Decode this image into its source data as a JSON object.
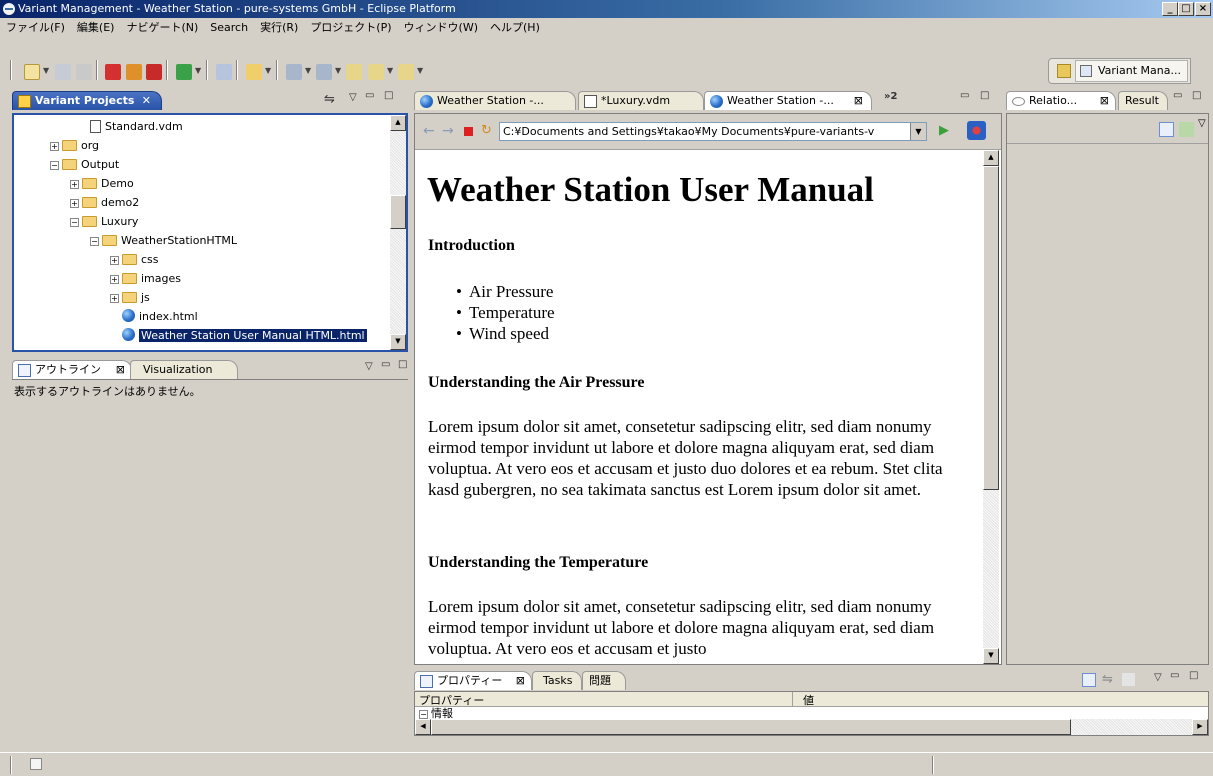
{
  "window": {
    "title": "Variant Management - Weather Station - pure-systems GmbH - Eclipse Platform"
  },
  "menu": [
    "ファイル(F)",
    "編集(E)",
    "ナビゲート(N)",
    "Search",
    "実行(R)",
    "プロジェクト(P)",
    "ウィンドウ(W)",
    "ヘルプ(H)"
  ],
  "perspective": {
    "label": "Variant Mana..."
  },
  "variant_projects": {
    "tab_label": "Variant Projects",
    "tree": [
      {
        "label": "Standard.vdm"
      },
      {
        "label": "org"
      },
      {
        "label": "Output"
      },
      {
        "label": "Demo"
      },
      {
        "label": "demo2"
      },
      {
        "label": "Luxury"
      },
      {
        "label": "WeatherStationHTML"
      },
      {
        "label": "css"
      },
      {
        "label": "images"
      },
      {
        "label": "js"
      },
      {
        "label": "index.html"
      },
      {
        "label": "Weather Station User Manual HTML.html"
      }
    ]
  },
  "outline": {
    "tabs": [
      "アウトライン",
      "Visualization"
    ],
    "message": "表示するアウトラインはありません。"
  },
  "editor": {
    "tabs": [
      "Weather Station -...",
      "*Luxury.vdm",
      "Weather Station -...",
      "»2"
    ],
    "address": "C:¥Documents and Settings¥takao¥My Documents¥pure-variants-v"
  },
  "document": {
    "title": "Weather Station User Manual",
    "intro_heading": "Introduction",
    "bullets": [
      "Air Pressure",
      "Temperature",
      "Wind speed"
    ],
    "section1_heading": "Understanding the Air Pressure",
    "section1_text": "Lorem ipsum dolor sit amet, consetetur sadipscing elitr, sed diam nonumy eirmod tempor invidunt ut labore et dolore magna aliquyam erat, sed diam voluptua. At vero eos et accusam et justo duo dolores et ea rebum. Stet clita kasd gubergren, no sea takimata sanctus est Lorem ipsum dolor sit amet.",
    "section2_heading": "Understanding the Temperature",
    "section2_text": "Lorem ipsum dolor sit amet, consetetur sadipscing elitr, sed diam nonumy eirmod tempor invidunt ut labore et dolore magna aliquyam erat, sed diam voluptua. At vero eos et accusam et justo"
  },
  "right_panel": {
    "tabs": [
      "Relatio...",
      "Result"
    ]
  },
  "properties": {
    "tabs": [
      "プロパティー",
      "Tasks",
      "問題"
    ],
    "columns": [
      "プロパティー",
      "値"
    ],
    "rows": [
      {
        "label": "情報"
      }
    ]
  },
  "colors": {
    "selection": "#0a246a",
    "titlebar": "#0a246a",
    "active_tab": "#2853a8"
  }
}
